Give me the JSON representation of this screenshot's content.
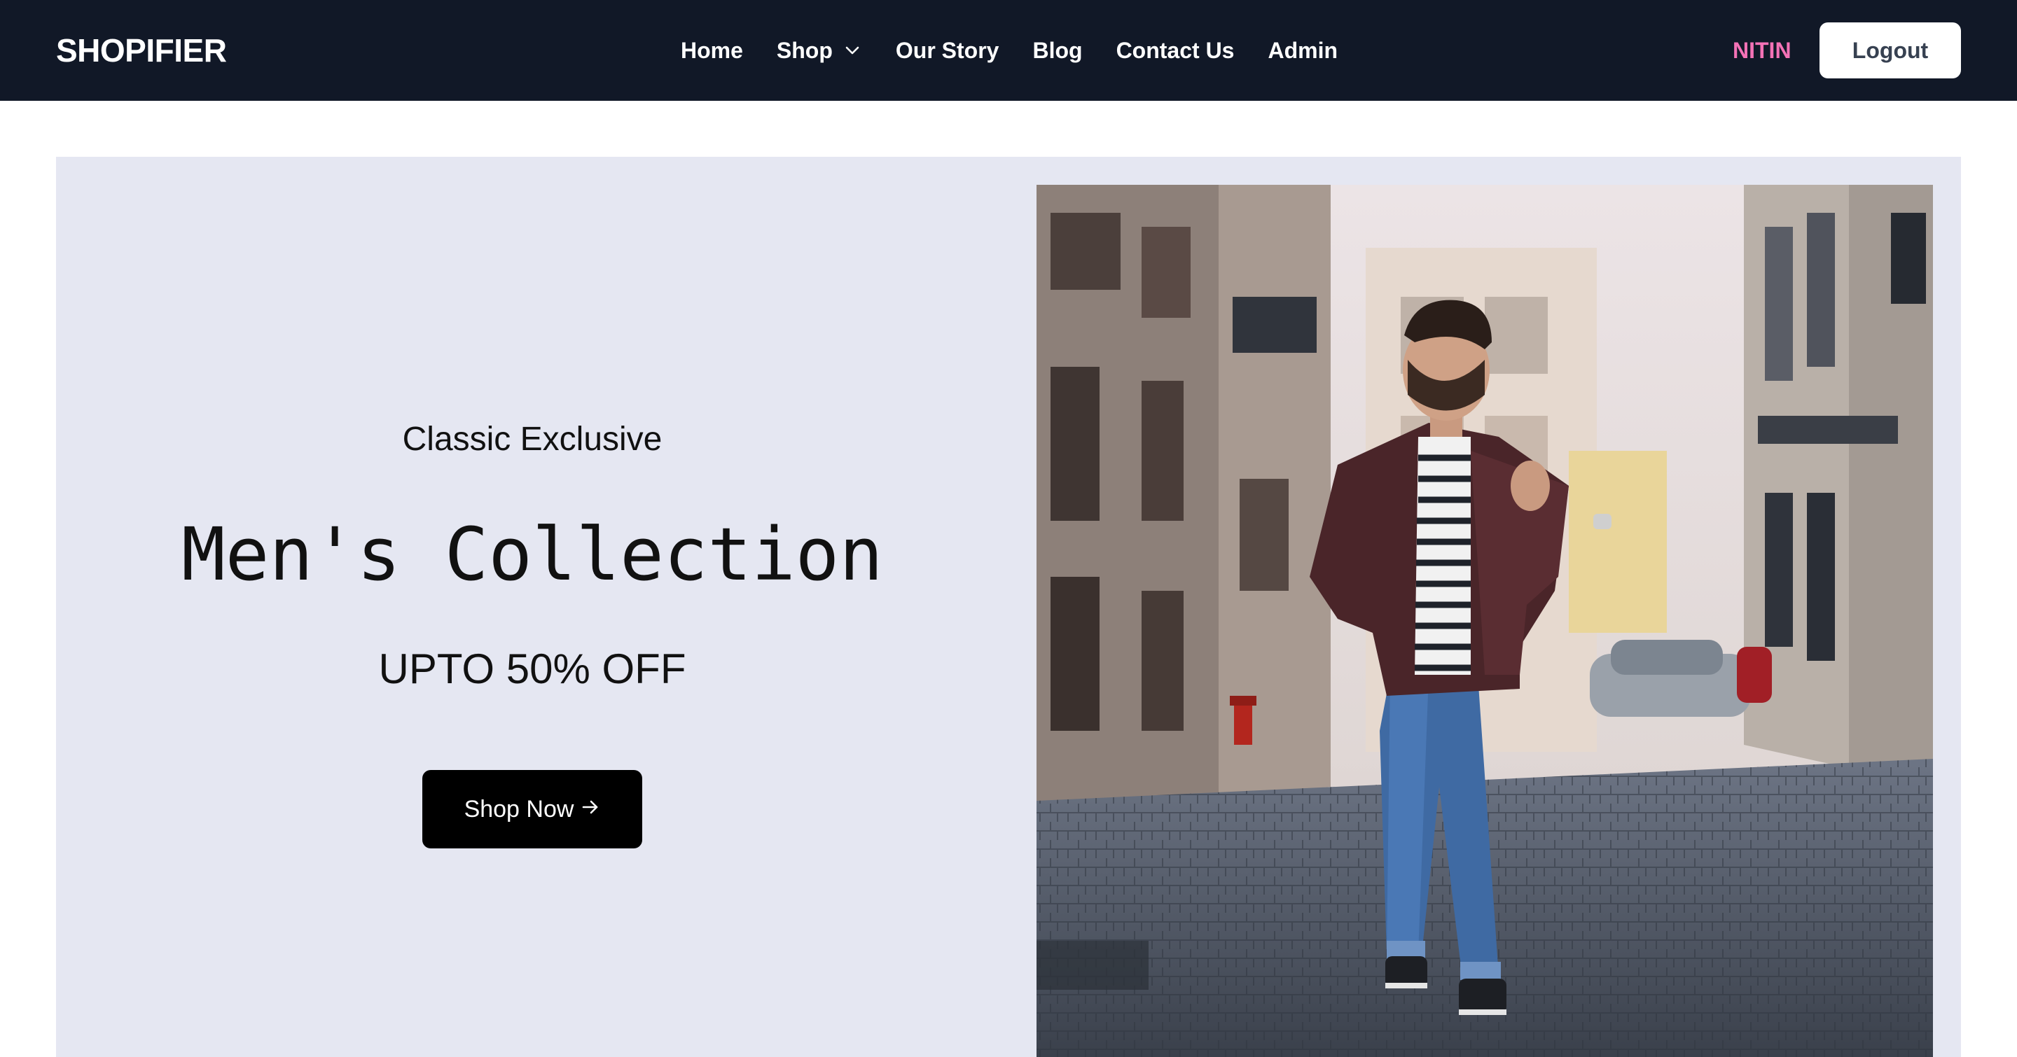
{
  "theme": {
    "nav_background": "#111827",
    "user_color": "#f472b6",
    "hero_background": "#e5e7f2",
    "button_color": "#000000"
  },
  "header": {
    "brand": "SHOPIFIER",
    "nav": [
      {
        "label": "Home"
      },
      {
        "label": "Shop",
        "icon": "chevron-down-icon"
      },
      {
        "label": "Our Story"
      },
      {
        "label": "Blog"
      },
      {
        "label": "Contact Us"
      },
      {
        "label": "Admin"
      }
    ],
    "user_name": "NITIN",
    "logout_label": "Logout"
  },
  "hero": {
    "eyebrow": "Classic Exclusive",
    "headline": "Men's Collection",
    "discount": "UPTO 50% OFF",
    "cta_label": "Shop Now",
    "cta_icon": "arrow-right-icon",
    "image_subject": "man in burgundy bomber jacket walking on cobblestone street"
  }
}
